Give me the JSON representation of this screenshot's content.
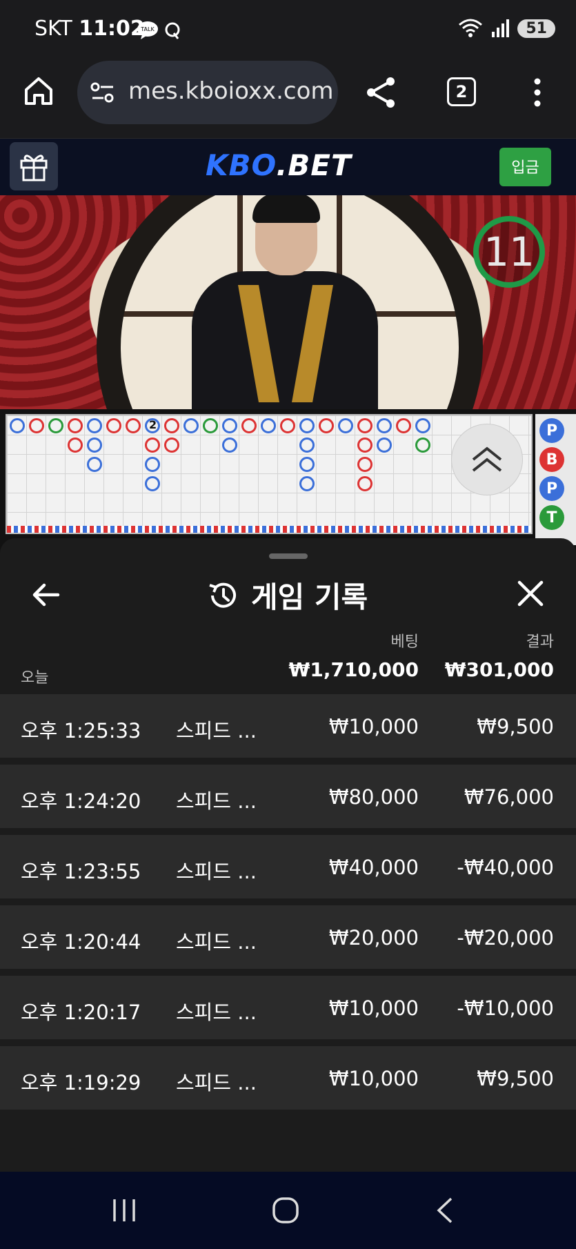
{
  "status_bar": {
    "carrier": "SKT",
    "time": "11:02",
    "talk_badge": "TALK",
    "battery": "51"
  },
  "browser": {
    "url": "mes.kboioxx.com",
    "tab_count": "2"
  },
  "site": {
    "logo_left": "KBO",
    "logo_right": ".BET",
    "deposit_label": "입금",
    "accent": "#2f73ff",
    "deposit_color": "#2ea043"
  },
  "live": {
    "timer": "11",
    "road_mark": "2",
    "predict_chips": [
      "P",
      "B",
      "P",
      "T"
    ]
  },
  "history": {
    "title": "게임 기록",
    "header_bet": "베팅",
    "header_result": "결과",
    "today_label": "오늘",
    "total_bet": "₩1,710,000",
    "total_result": "₩301,000",
    "rows": [
      {
        "time": "오후 1:25:33",
        "game": "스피드 ...",
        "bet": "₩10,000",
        "result": "₩9,500"
      },
      {
        "time": "오후 1:24:20",
        "game": "스피드 ...",
        "bet": "₩80,000",
        "result": "₩76,000"
      },
      {
        "time": "오후 1:23:55",
        "game": "스피드 ...",
        "bet": "₩40,000",
        "result": "-₩40,000"
      },
      {
        "time": "오후 1:20:44",
        "game": "스피드 ...",
        "bet": "₩20,000",
        "result": "-₩20,000"
      },
      {
        "time": "오후 1:20:17",
        "game": "스피드 ...",
        "bet": "₩10,000",
        "result": "-₩10,000"
      },
      {
        "time": "오후 1:19:29",
        "game": "스피드 ...",
        "bet": "₩10,000",
        "result": "₩9,500"
      }
    ]
  }
}
